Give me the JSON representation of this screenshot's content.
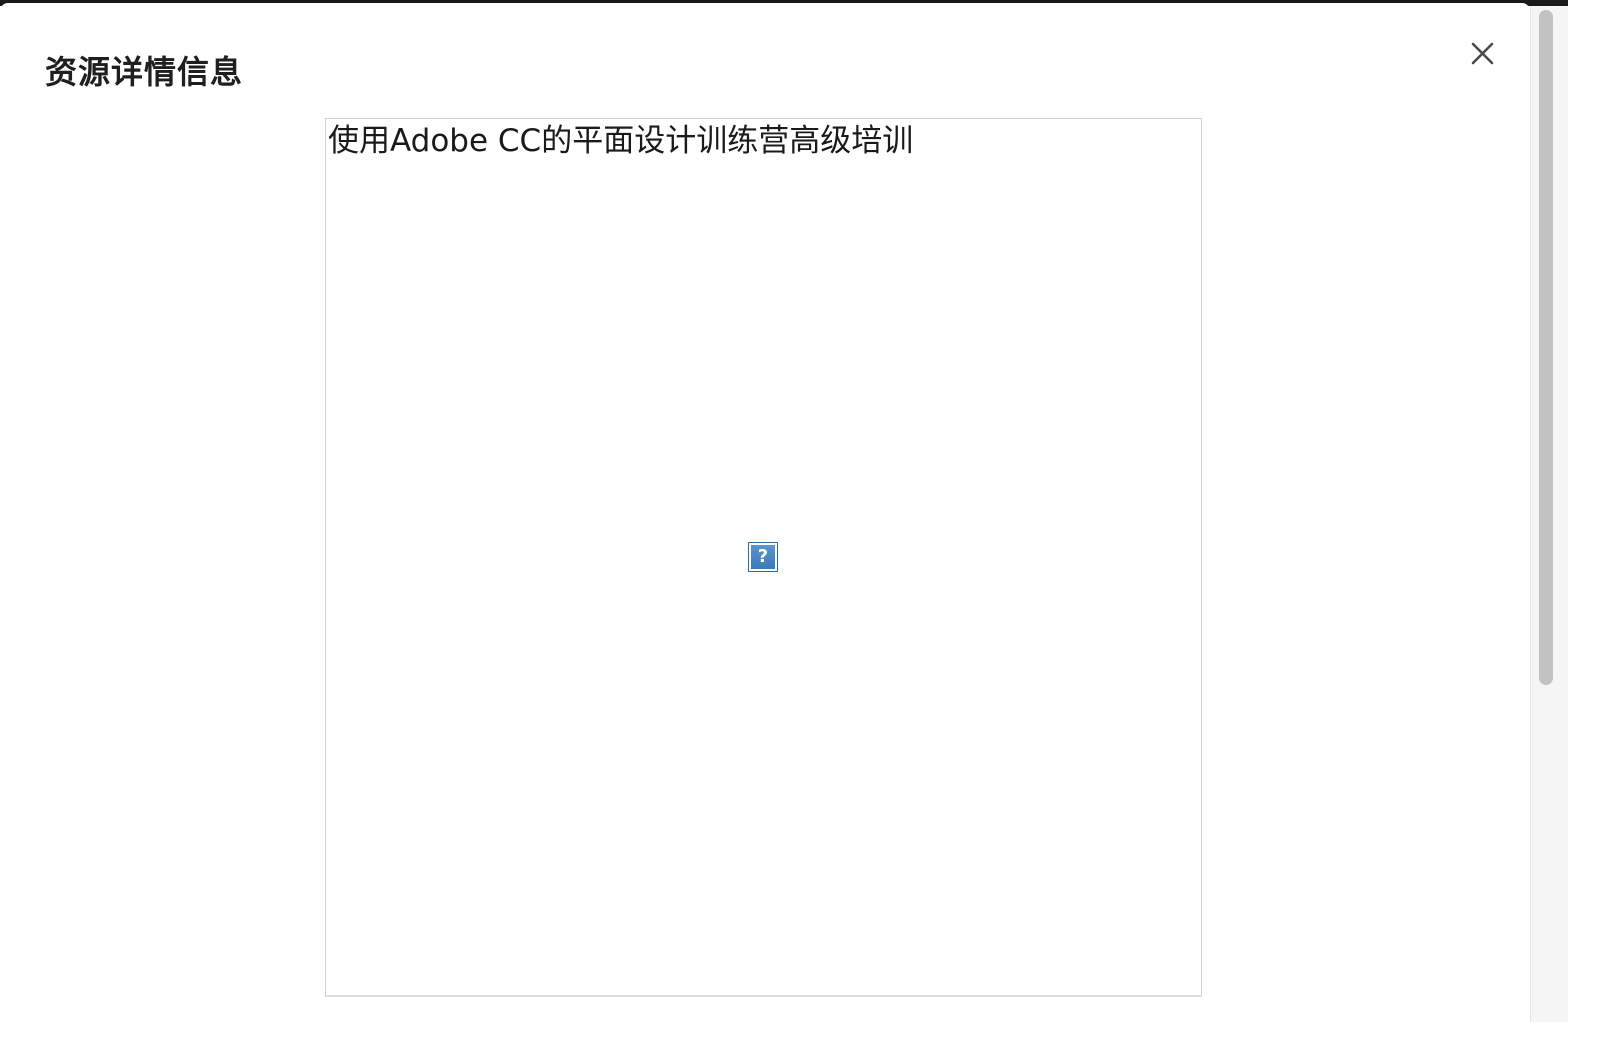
{
  "dialog": {
    "title": "资源详情信息",
    "close_icon": "close-icon"
  },
  "preview": {
    "alt_text": "使用Adobe CC的平面设计训练营高级培训",
    "broken_image_icon": "broken-image-icon",
    "broken_image_glyph": "?"
  },
  "scrollbar": {
    "visible_fraction": 0.67,
    "scroll_position": 0
  }
}
